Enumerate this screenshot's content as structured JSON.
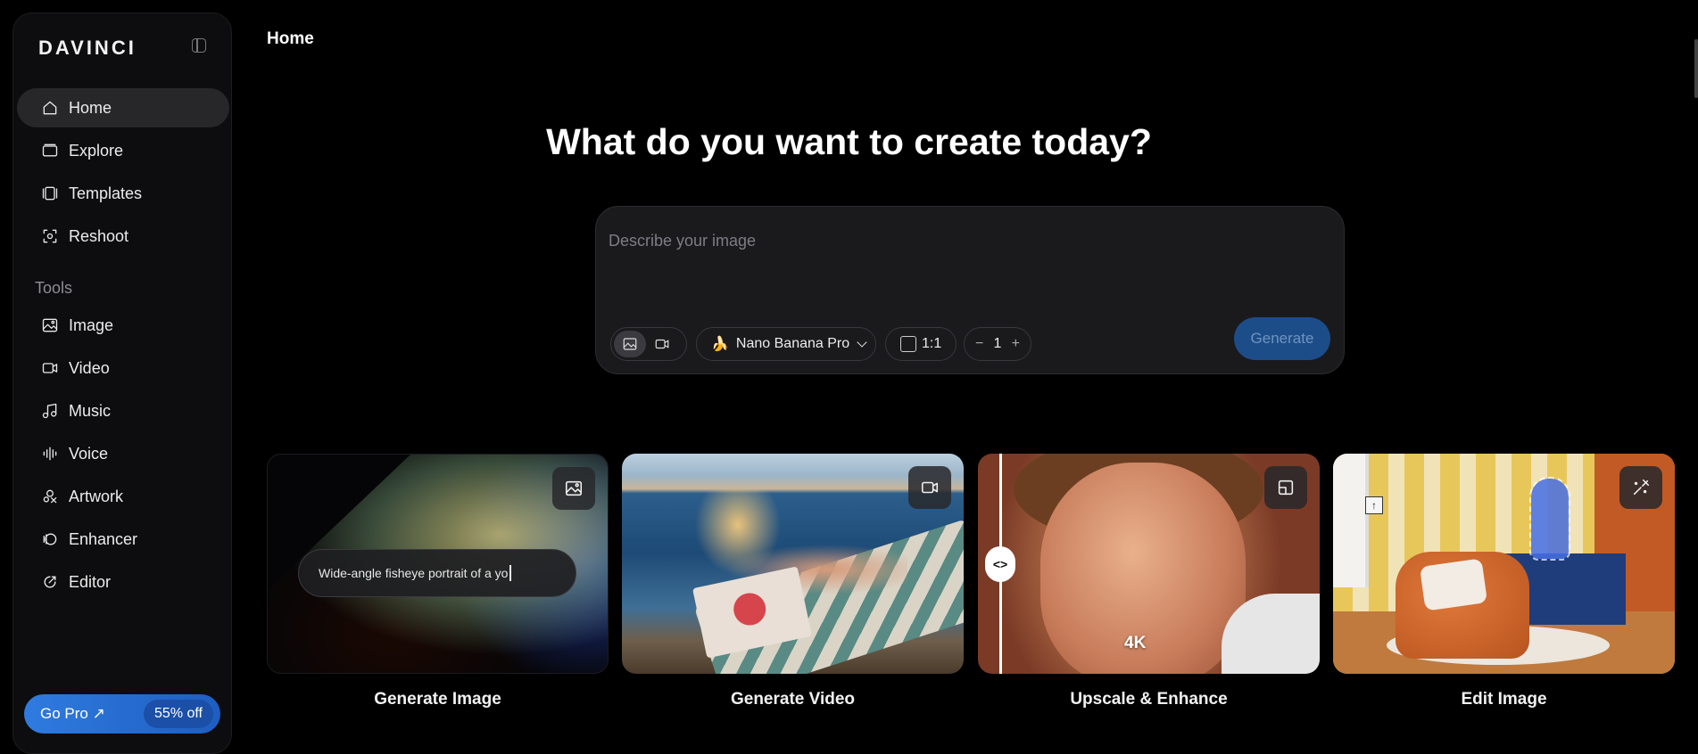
{
  "brand": {
    "logo": "DAVINCI"
  },
  "sidebar": {
    "nav": [
      {
        "label": "Home",
        "icon": "home-icon",
        "active": true
      },
      {
        "label": "Explore",
        "icon": "explore-icon"
      },
      {
        "label": "Templates",
        "icon": "templates-icon"
      },
      {
        "label": "Reshoot",
        "icon": "reshoot-icon"
      }
    ],
    "tools_label": "Tools",
    "tools": [
      {
        "label": "Image",
        "icon": "image-icon"
      },
      {
        "label": "Video",
        "icon": "video-icon"
      },
      {
        "label": "Music",
        "icon": "music-icon"
      },
      {
        "label": "Voice",
        "icon": "voice-icon"
      },
      {
        "label": "Artwork",
        "icon": "artwork-icon"
      },
      {
        "label": "Enhancer",
        "icon": "enhancer-icon"
      },
      {
        "label": "Editor",
        "icon": "editor-icon"
      }
    ],
    "go_pro": {
      "label": "Go Pro ↗",
      "badge": "55% off"
    }
  },
  "header": {
    "title": "Home"
  },
  "hero": {
    "title": "What do you want to create today?"
  },
  "prompt": {
    "placeholder": "Describe your image",
    "model": "Nano Banana Pro",
    "ratio": "1:1",
    "count_minus": "−",
    "count": "1",
    "count_plus": "+",
    "generate_label": "Generate"
  },
  "cards": [
    {
      "title": "Generate Image",
      "icon": "image-icon",
      "prompt_text": "Wide-angle fisheye portrait of a yo"
    },
    {
      "title": "Generate Video",
      "icon": "video-icon"
    },
    {
      "title": "Upscale & Enhance",
      "icon": "upscale-icon",
      "badge": "4K",
      "split_handle": "<>"
    },
    {
      "title": "Edit Image",
      "icon": "edit-icon"
    }
  ],
  "colors": {
    "accent": "#1d4d88",
    "gopro": "#2f7be0",
    "background": "#000000",
    "sidebar": "#0d0d0f"
  }
}
